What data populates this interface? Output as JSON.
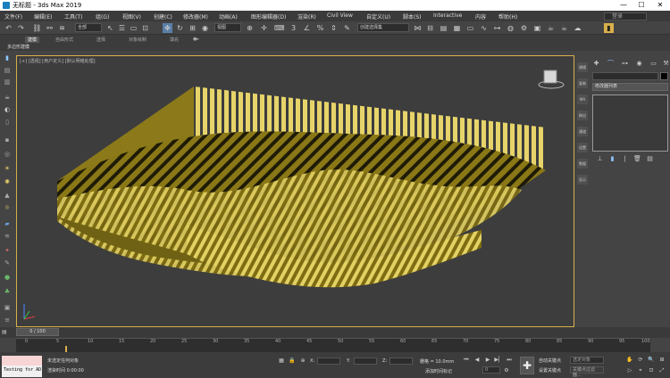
{
  "title_bar": {
    "title": "无标题 - 3ds Max 2019"
  },
  "menu": {
    "items": [
      "文件(F)",
      "编辑(E)",
      "工具(T)",
      "组(G)",
      "视图(V)",
      "创建(C)",
      "修改器(M)",
      "动画(A)",
      "图形编辑器(D)",
      "渲染(R)",
      "Civil View",
      "自定义(U)",
      "脚本(S)",
      "Interactive",
      "内容",
      "帮助(H)"
    ],
    "search_placeholder": "登录"
  },
  "toolbar": {
    "selection_filter": "全部",
    "view_dropdown": "视图",
    "named_selection": "创建选择集"
  },
  "ribbon": {
    "tabs": [
      "建模",
      "自由形式",
      "选择",
      "对象绘制",
      "填充"
    ],
    "subtitle": "多边形建模"
  },
  "viewport": {
    "label": "[+] [透视] [用户定义] [默认明暗处理]"
  },
  "command_panel": {
    "tabs": [
      "建模",
      "复制",
      "MA",
      "刷出",
      "通道",
      "设置",
      "数据",
      "显示"
    ],
    "modifier_list": "修改器列表"
  },
  "timeline": {
    "slider": "0 / 100",
    "ticks": [
      "0",
      "5",
      "10",
      "15",
      "20",
      "25",
      "30",
      "35",
      "40",
      "45",
      "50",
      "55",
      "60",
      "65",
      "70",
      "75",
      "80",
      "85",
      "90",
      "95",
      "100"
    ]
  },
  "status": {
    "maxscript_label": "Testing for AD",
    "line1": "未选定任何对象",
    "line2": "渲染时间  0:00:00",
    "x_label": "X:",
    "y_label": "Y:",
    "z_label": "Z:",
    "grid": "栅格 = 10.0mm",
    "add_time_tag": "添加时间标记",
    "auto_key": "自动关键点",
    "set_key": "设置关键点",
    "selected_object": "选定对象",
    "key_filters": "关键点过滤器...",
    "frame": "0"
  },
  "colors": {
    "viewport_border": "#d9b04a",
    "mesh": "#a08c1c",
    "stripes": "#e0cf5c"
  }
}
